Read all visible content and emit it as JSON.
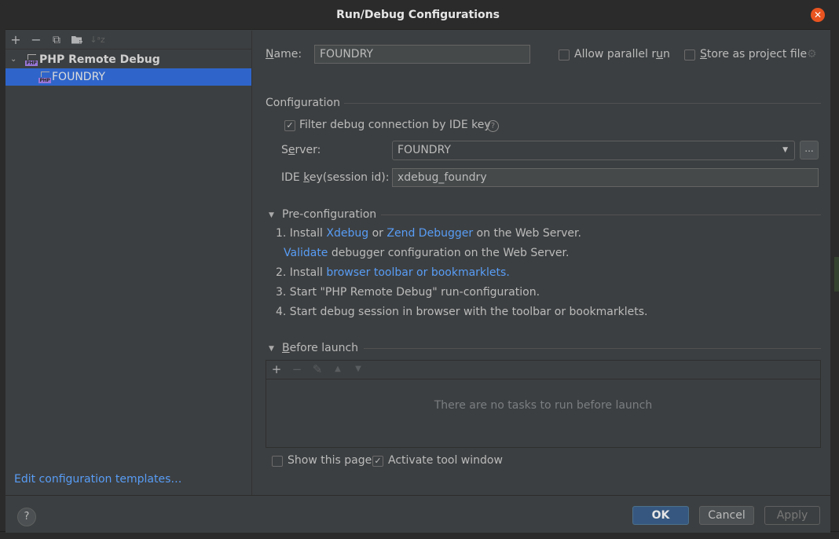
{
  "window": {
    "title": "Run/Debug Configurations"
  },
  "left_toolbar": {
    "add": "+",
    "remove": "−",
    "copy": "⧉",
    "folder": "▰",
    "sort": "↓ᵃz"
  },
  "tree": {
    "group_label": "PHP Remote Debug",
    "group_icon_text": "PHP",
    "items": [
      {
        "label": "FOUNDRY",
        "icon_text": "PHP",
        "selected": true
      }
    ]
  },
  "edit_templates_link": "Edit configuration templates…",
  "form": {
    "name_label_prefix": "N",
    "name_label_rest": "ame:",
    "name_value": "FOUNDRY",
    "allow_parallel_label_a": "Allow parallel r",
    "allow_parallel_label_u": "u",
    "allow_parallel_label_b": "n",
    "allow_parallel_checked": false,
    "store_label_prefix": "S",
    "store_label_rest": "tore as project file",
    "store_checked": false,
    "configuration_section": "Configuration",
    "filter_label": "Filter debug connection by IDE key",
    "filter_checked": true,
    "help_glyph": "?",
    "server_label_a": "S",
    "server_label_u": "e",
    "server_label_b": "rver:",
    "server_value": "FOUNDRY",
    "browse_label": "...",
    "idekey_label_a": "IDE ",
    "idekey_label_u": "k",
    "idekey_label_b": "ey(session id):",
    "idekey_value": "xdebug_foundry"
  },
  "preconfig": {
    "title": "Pre-configuration",
    "step1_a": "1. Install ",
    "step1_link1": "Xdebug",
    "step1_b": " or ",
    "step1_link2": "Zend Debugger",
    "step1_c": " on the Web Server.",
    "validate_link": "Validate",
    "validate_rest": " debugger configuration on the Web Server.",
    "step2_a": "2. Install ",
    "step2_link": "browser toolbar or bookmarklets.",
    "step3": "3. Start \"PHP Remote Debug\" run-configuration.",
    "step4": "4. Start debug session in browser with the toolbar or bookmarklets."
  },
  "before_launch": {
    "title_u": "B",
    "title_rest": "efore launch",
    "empty_text": "There are no tasks to run before launch",
    "toolbar": {
      "add": "+",
      "remove": "−",
      "edit": "✎",
      "up": "▲",
      "down": "▼"
    }
  },
  "options": {
    "show_page_label": "Show this page",
    "show_page_checked": false,
    "activate_label": "Activate tool window",
    "activate_checked": true,
    "check_glyph": "✓"
  },
  "footer": {
    "help": "?",
    "ok": "OK",
    "cancel": "Cancel",
    "apply": "Apply"
  },
  "colors": {
    "accent_link": "#589df6",
    "selection": "#2f65ca",
    "ok_button": "#365880",
    "close_button": "#e95420",
    "php_icon": "#9876d9"
  }
}
